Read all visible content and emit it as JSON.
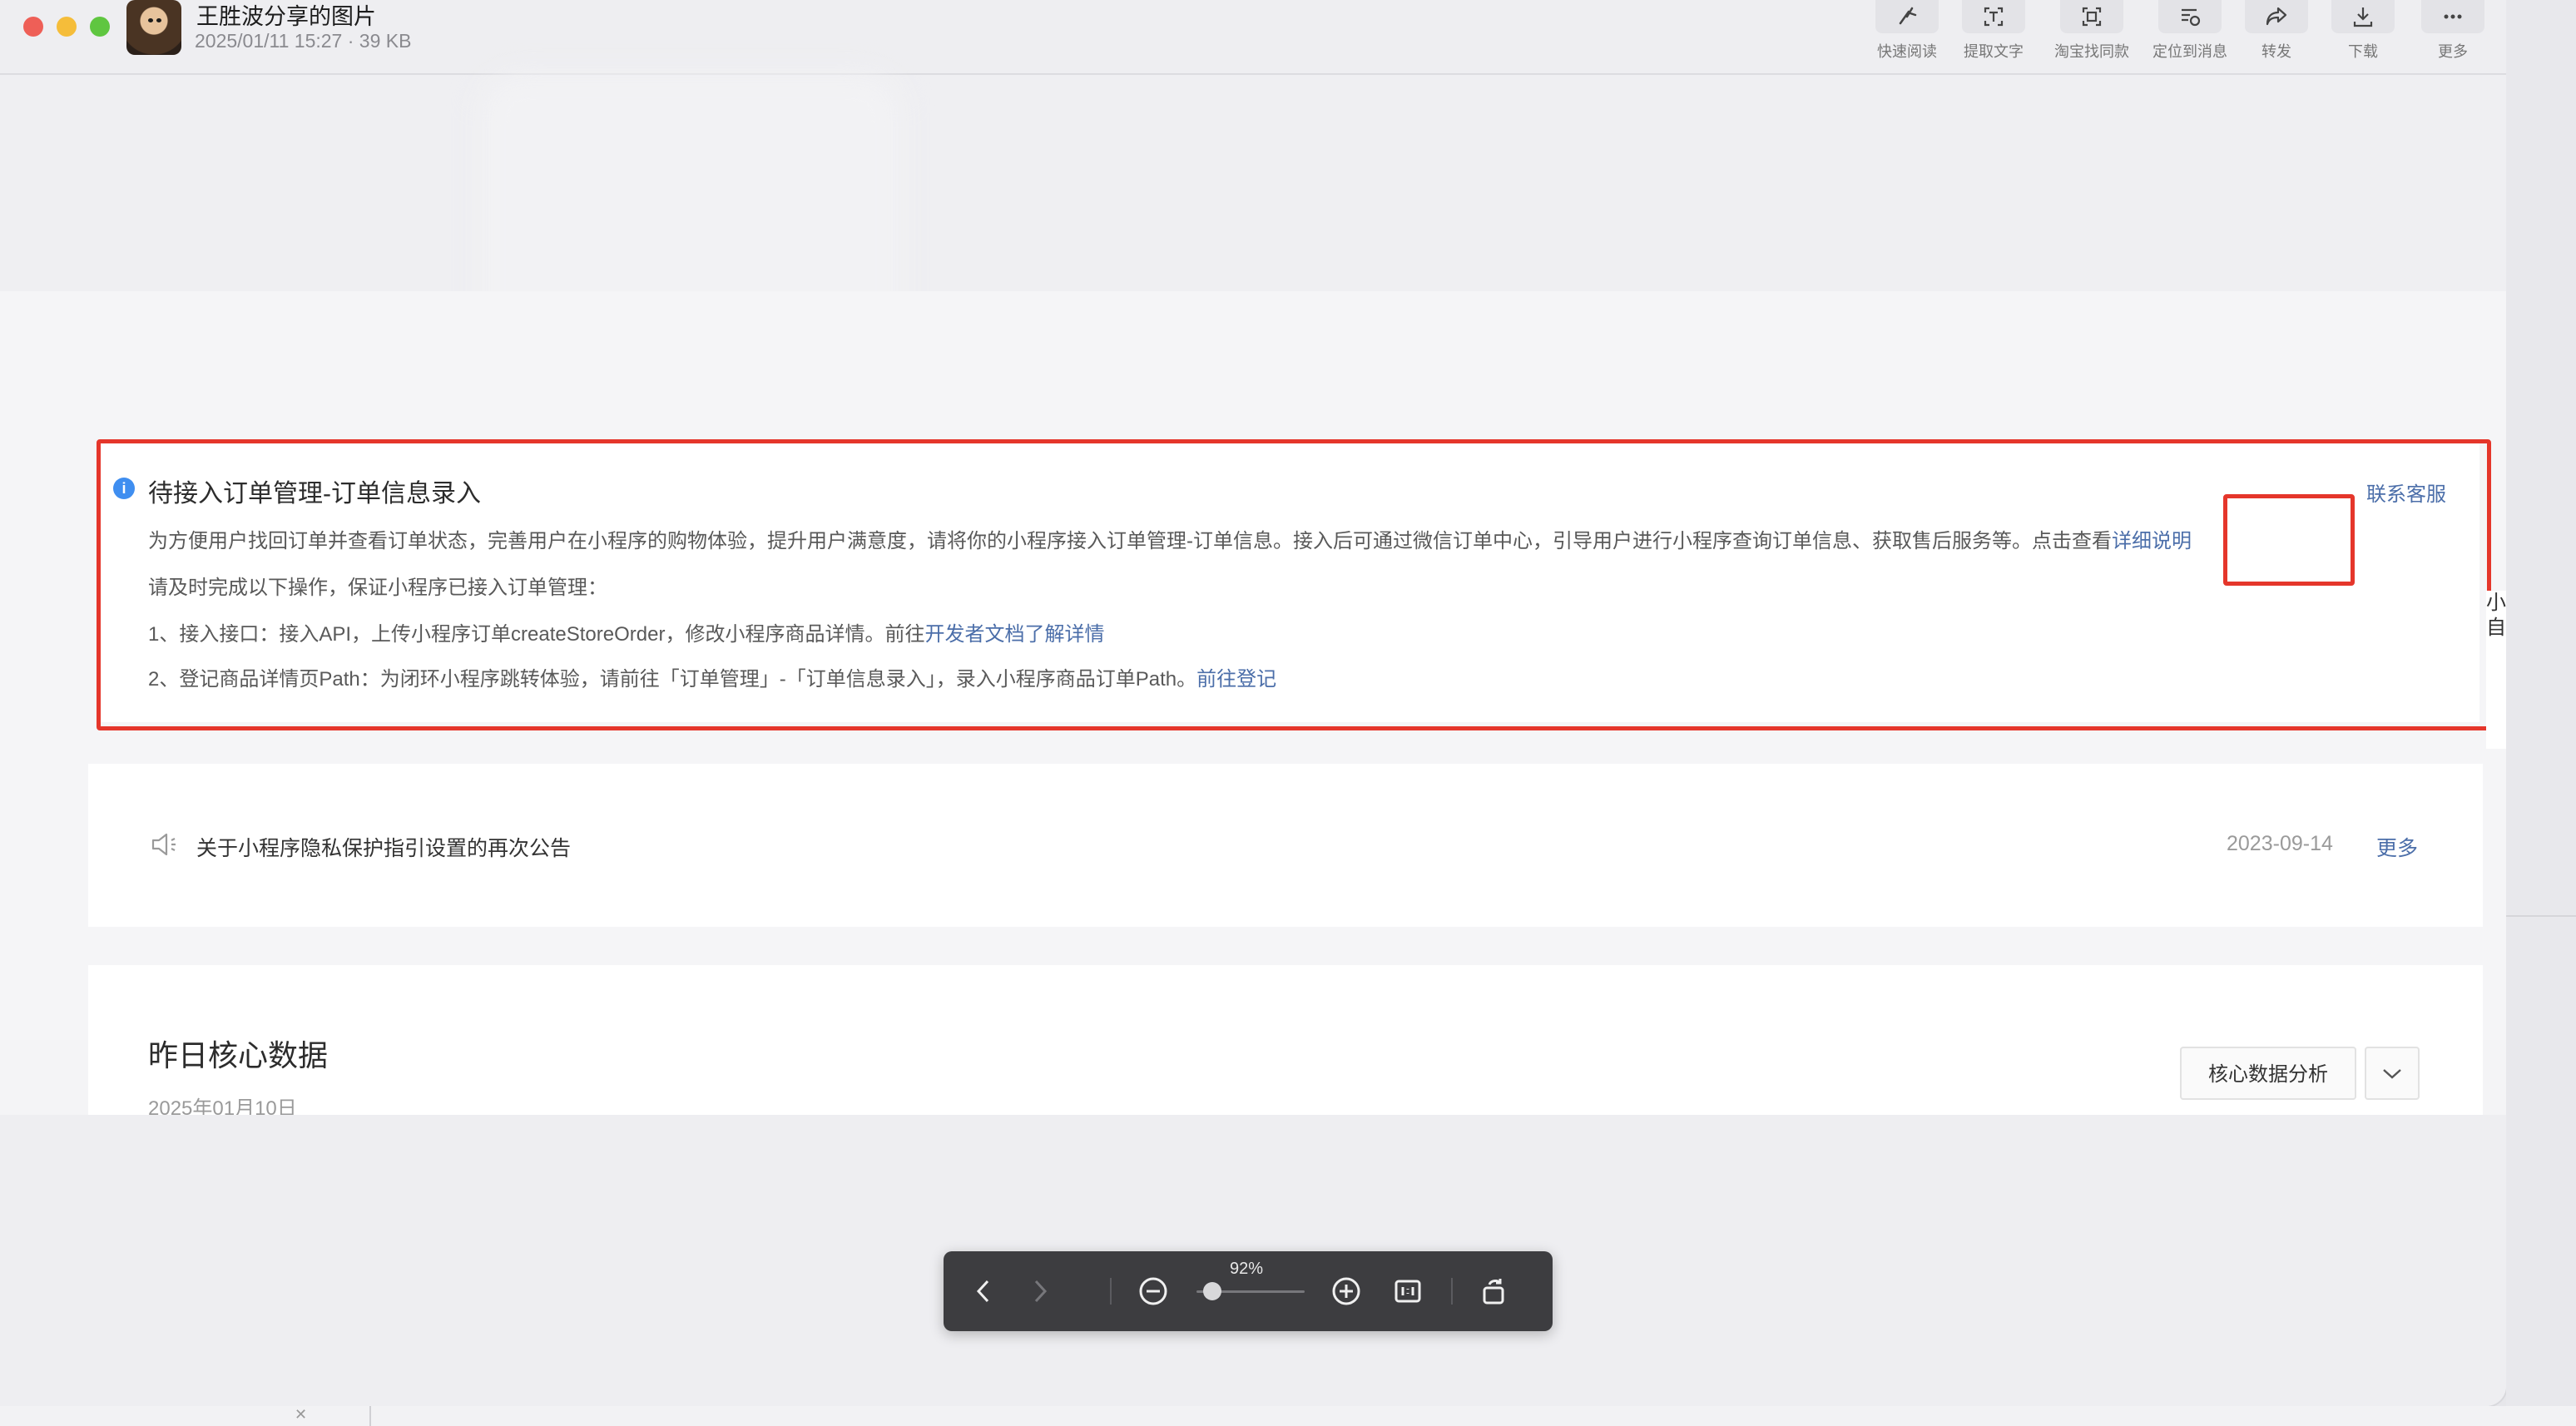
{
  "window": {
    "title": "王胜波分享的图片",
    "meta": "2025/01/11 15:27 · 39 KB"
  },
  "toolbar": {
    "items": [
      {
        "label": "快速阅读",
        "icon": "quick-read-icon"
      },
      {
        "label": "提取文字",
        "icon": "extract-text-icon"
      },
      {
        "label": "淘宝找同款",
        "icon": "taobao-search-icon"
      },
      {
        "label": "定位到消息",
        "icon": "locate-message-icon"
      },
      {
        "label": "转发",
        "icon": "forward-icon"
      },
      {
        "label": "下载",
        "icon": "download-icon"
      },
      {
        "label": "更多",
        "icon": "more-icon"
      }
    ]
  },
  "notice": {
    "title": "待接入订单管理-订单信息录入",
    "contact": "联系客服",
    "desc_prefix": "为方便用户找回订单并查看订单状态，完善用户在小程序的购物体验，提升用户满意度，请将你的小程序接入订单管理-订单信息。接入后可通过微信订单中心，引导用户进行小程序查询订单信息、获取售后服务等。点击查看",
    "desc_link": "详细说明",
    "instruction": "请及时完成以下操作，保证小程序已接入订单管理：",
    "step1_text": "1、接入接口：接入API，上传小程序订单createStoreOrder，修改小程序商品详情。前往",
    "step1_link": "开发者文档了解详情",
    "step2_text": "2、登记商品详情页Path：为闭环小程序跳转体验，请前往「订单管理」-「订单信息录入」，录入小程序商品订单Path。",
    "step2_link": "前往登记",
    "info_icon": "i"
  },
  "announcement": {
    "text": "关于小程序隐私保护指引设置的再次公告",
    "date": "2023-09-14",
    "more": "更多",
    "icon": "speaker-icon"
  },
  "core_data": {
    "title": "昨日核心数据",
    "date": "2025年01月10日",
    "button": "核心数据分析"
  },
  "right_partial": {
    "line1": "小",
    "line2": "自"
  },
  "viewer_bar": {
    "zoom": "92%",
    "zoom_level": 0.92
  },
  "colors": {
    "highlight_red": "#e5362b",
    "link_blue": "#4b6ea9",
    "info_blue": "#3f8ef0",
    "toolbar_bg": "#3d3d40"
  }
}
